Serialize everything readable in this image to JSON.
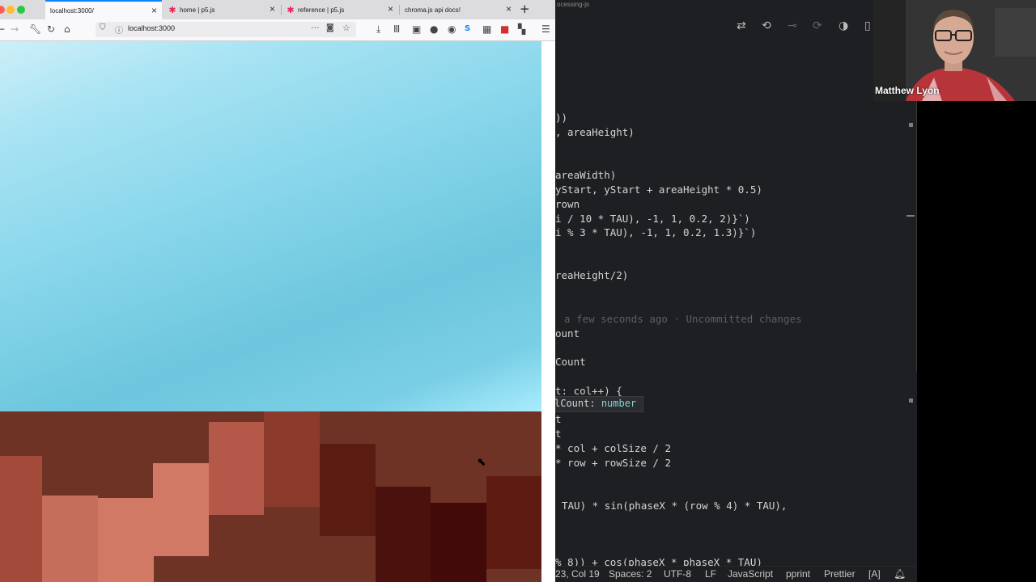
{
  "browser": {
    "tabs": [
      {
        "label": "localhost:3000/",
        "active": true
      },
      {
        "label": "home | p5.js",
        "active": false
      },
      {
        "label": "reference | p5.js",
        "active": false
      },
      {
        "label": "chroma.js api docs!",
        "active": false
      }
    ],
    "new_tab": "+",
    "url": "localhost:3000",
    "colors": {
      "sky_top": "#cdeff8",
      "sky_bottom": "#a9ecfc",
      "ground": "#6f3326"
    }
  },
  "editor": {
    "title_fragment": "ocessing-js",
    "lines": [
      {
        "text": "))"
      },
      {
        "text": ", areaHeight)"
      },
      {
        "text": "areaWidth)"
      },
      {
        "text": "yStart, yStart + areaHeight * 0.5)"
      },
      {
        "text": "rown"
      },
      {
        "text": "i / 10 * TAU), -1, 1, 0.2, 2)}`)"
      },
      {
        "text": "i % 3 * TAU), -1, 1, 0.2, 1.3)}`)"
      },
      {
        "text": "reaHeight/2)"
      },
      {
        "text": "ount"
      },
      {
        "text": "Count"
      },
      {
        "text": "t: col++) {"
      },
      {
        "text": "t"
      },
      {
        "text": "t"
      },
      {
        "text": "* col + colSize / 2"
      },
      {
        "text": "* row + rowSize / 2"
      },
      {
        "text": "TAU) * sin(phaseX * (row % 4) * TAU),"
      },
      {
        "text": "% 8)) + cos(phaseX * phaseX * TAU)"
      }
    ],
    "blame": "a few seconds ago · Uncommitted changes",
    "hint": {
      "name": "lCount",
      "type": "number"
    },
    "status": {
      "position": "23, Col 19",
      "spaces": "Spaces: 2",
      "encoding": "UTF-8",
      "eol": "LF",
      "language": "JavaScript",
      "formatter1": "pprint",
      "formatter2": "Prettier",
      "mode": "[A]"
    }
  },
  "video": {
    "name": "Matthew Lyon"
  }
}
